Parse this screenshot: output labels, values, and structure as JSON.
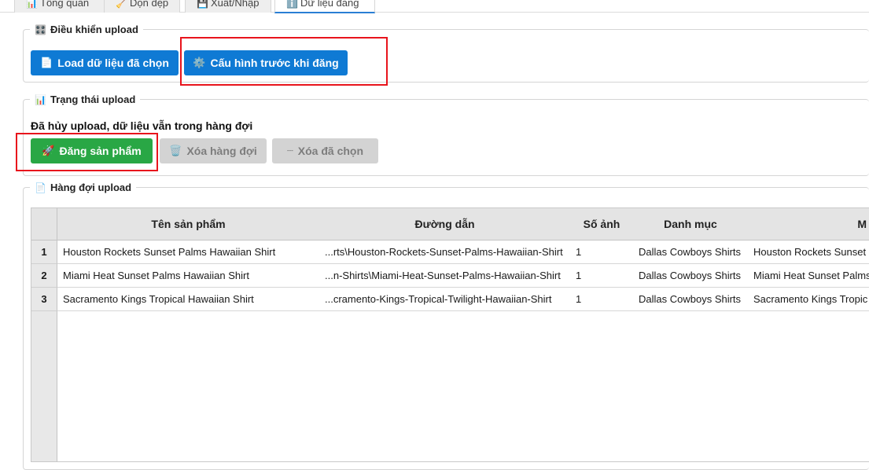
{
  "tabs": [
    {
      "label": "Tổng quan",
      "icon": "chart-icon"
    },
    {
      "label": "Dọn dẹp",
      "icon": "broom-icon"
    },
    {
      "label": "Xuất/Nhập",
      "icon": "import-export-icon"
    },
    {
      "label": "Dữ liệu đăng",
      "icon": "info-icon",
      "active": true
    }
  ],
  "upload_controls": {
    "title": "Điều khiển upload",
    "load_label": "Load dữ liệu đã chọn",
    "config_label": "Cấu hình trước khi đăng"
  },
  "upload_status": {
    "title": "Trạng thái upload",
    "message": "Đã hủy upload, dữ liệu vẫn trong hàng đợi",
    "post_label": "Đăng sản phẩm",
    "clear_queue_label": "Xóa hàng đợi",
    "clear_selected_label": "Xóa đã chọn"
  },
  "queue": {
    "title": "Hàng đợi upload",
    "columns": [
      "Tên sản phẩm",
      "Đường dẫn",
      "Số ảnh",
      "Danh mục",
      "M"
    ],
    "rows": [
      {
        "num": "1",
        "name": "Houston Rockets Sunset Palms Hawaiian Shirt",
        "path": "...rts\\Houston-Rockets-Sunset-Palms-Hawaiian-Shirt",
        "images": "1",
        "category": "Dallas Cowboys Shirts",
        "extra": "Houston Rockets Sunset"
      },
      {
        "num": "2",
        "name": "Miami Heat Sunset Palms Hawaiian Shirt",
        "path": "...n-Shirts\\Miami-Heat-Sunset-Palms-Hawaiian-Shirt",
        "images": "1",
        "category": "Dallas Cowboys Shirts",
        "extra": "Miami Heat Sunset Palms"
      },
      {
        "num": "3",
        "name": "Sacramento Kings Tropical Hawaiian Shirt",
        "path": "...cramento-Kings-Tropical-Twilight-Hawaiian-Shirt",
        "images": "1",
        "category": "Dallas Cowboys Shirts",
        "extra": "Sacramento Kings Tropic"
      }
    ]
  },
  "colors": {
    "primary": "#0f7ad4",
    "success": "#29a745",
    "disabled": "#d3d3d3",
    "highlight": "#e8141c"
  }
}
